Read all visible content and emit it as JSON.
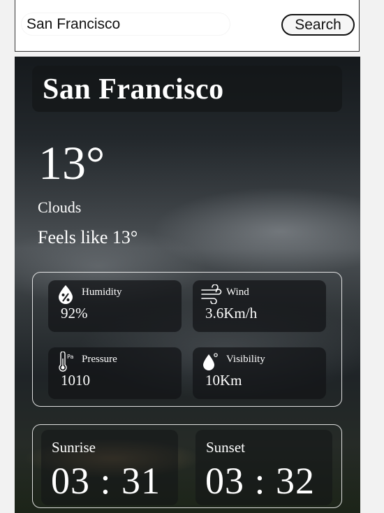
{
  "search": {
    "value": "San Francisco",
    "button_label": "Search"
  },
  "weather": {
    "city": "San Francisco",
    "temperature": "13°",
    "condition": "Clouds",
    "feels_like": "Feels like 13°"
  },
  "details": {
    "humidity": {
      "label": "Humidity",
      "value": "92%",
      "icon": "humidity-drop-percent-icon"
    },
    "wind": {
      "label": "Wind",
      "value": "3.6Km/h",
      "icon": "wind-icon"
    },
    "pressure": {
      "label": "Pressure",
      "value": "1010",
      "icon": "thermometer-pressure-icon"
    },
    "visibility": {
      "label": "Visibility",
      "value": "10Km",
      "icon": "water-drop-icon"
    }
  },
  "sun": {
    "sunrise": {
      "label": "Sunrise",
      "time": "03 : 31"
    },
    "sunset": {
      "label": "Sunset",
      "time": "03 : 32"
    }
  }
}
